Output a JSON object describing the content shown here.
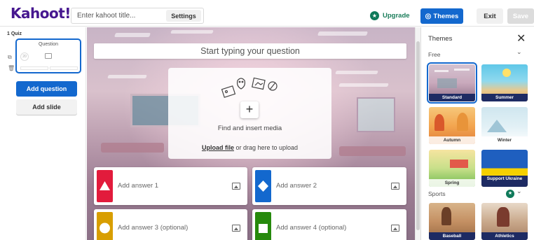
{
  "header": {
    "logo": "Kahoot!",
    "title_placeholder": "Enter kahoot title...",
    "settings_label": "Settings",
    "upgrade_label": "Upgrade",
    "themes_label": "Themes",
    "exit_label": "Exit",
    "save_label": "Save"
  },
  "sidebar": {
    "slide_label": "1  Quiz",
    "thumb_title": "Question",
    "thumb_timer": "20",
    "add_question": "Add question",
    "add_slide": "Add slide"
  },
  "editor": {
    "question_placeholder": "Start typing your question",
    "find_media": "Find and insert media",
    "upload_link": "Upload file",
    "upload_rest": " or drag here to upload",
    "answers": [
      {
        "label": "Add answer 1",
        "color": "#e21b3c",
        "shape": "triangle"
      },
      {
        "label": "Add answer 2",
        "color": "#1368ce",
        "shape": "diamond"
      },
      {
        "label": "Add answer 3 (optional)",
        "color": "#d89e00",
        "shape": "circle"
      },
      {
        "label": "Add answer 4 (optional)",
        "color": "#26890c",
        "shape": "square"
      }
    ]
  },
  "themes_panel": {
    "title": "Themes",
    "free_label": "Free",
    "sports_label": "Sports",
    "free_themes": [
      "Standard",
      "Summer",
      "Autumn",
      "Winter",
      "Spring",
      "Support Ukraine"
    ],
    "sports_themes": [
      "Baseball",
      "Athletics"
    ],
    "selected": "Standard"
  }
}
